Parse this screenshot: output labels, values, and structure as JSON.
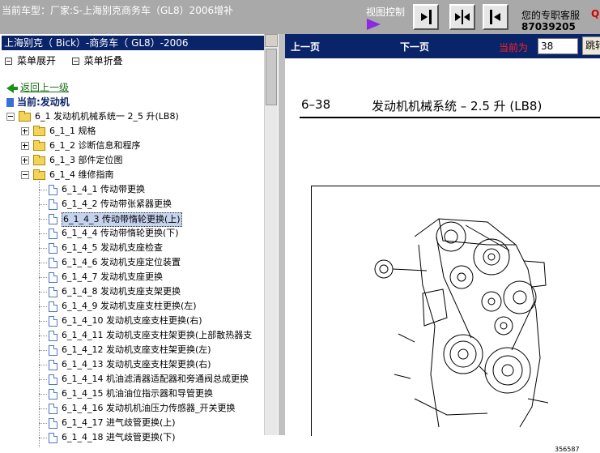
{
  "header": {
    "vehicle_label": "当前车型：厂家:S-上海别克商务车（GL8）2006增补",
    "view_control_label": "视图控制",
    "support_label": "您的专职客服",
    "support_mark": "Q",
    "support_phone": "87039205",
    "view_buttons": [
      "expand-right",
      "split-view",
      "collapse-left"
    ]
  },
  "sidebar": {
    "title": "上海别克（ Bick）-商务车（ GL8）-2006",
    "expand_all": "菜单展开",
    "collapse_all": "菜单折叠",
    "back_label": "返回上一级",
    "current_label": "当前:发动机",
    "tree": [
      {
        "label": "6_1 发动机机械系统一 2_5 升(LB8)",
        "level": 0,
        "type": "folder",
        "expanded": true
      },
      {
        "label": "6_1_1 规格",
        "level": 1,
        "type": "folder",
        "expanded": false
      },
      {
        "label": "6_1_2 诊断信息和程序",
        "level": 1,
        "type": "folder",
        "expanded": false
      },
      {
        "label": "6_1_3 部件定位图",
        "level": 1,
        "type": "folder",
        "expanded": false
      },
      {
        "label": "6_1_4 维修指南",
        "level": 1,
        "type": "folder",
        "expanded": true
      },
      {
        "label": "6_1_4_1 传动带更换",
        "level": 2,
        "type": "page"
      },
      {
        "label": "6_1_4_2 传动带张紧器更换",
        "level": 2,
        "type": "page"
      },
      {
        "label": "6_1_4_3 传动带惰轮更换(上)",
        "level": 2,
        "type": "page",
        "selected": true
      },
      {
        "label": "6_1_4_4 传动带惰轮更换(下)",
        "level": 2,
        "type": "page"
      },
      {
        "label": "6_1_4_5 发动机支座检查",
        "level": 2,
        "type": "page"
      },
      {
        "label": "6_1_4_6 发动机支座定位装置",
        "level": 2,
        "type": "page"
      },
      {
        "label": "6_1_4_7 发动机支座更换",
        "level": 2,
        "type": "page"
      },
      {
        "label": "6_1_4_8 发动机支座支架更换",
        "level": 2,
        "type": "page"
      },
      {
        "label": "6_1_4_9 发动机支座支柱更换(左)",
        "level": 2,
        "type": "page"
      },
      {
        "label": "6_1_4_10 发动机支座支柱更换(右)",
        "level": 2,
        "type": "page"
      },
      {
        "label": "6_1_4_11 发动机支座支柱架更换(上部散热器支",
        "level": 2,
        "type": "page"
      },
      {
        "label": "6_1_4_12 发动机支座支柱架更换(左)",
        "level": 2,
        "type": "page"
      },
      {
        "label": "6_1_4_13 发动机支座支柱架更换(右)",
        "level": 2,
        "type": "page"
      },
      {
        "label": "6_1_4_14 机油滤清器适配器和旁通阀总成更换",
        "level": 2,
        "type": "page"
      },
      {
        "label": "6_1_4_15 机油油位指示器和导管更换",
        "level": 2,
        "type": "page"
      },
      {
        "label": "6_1_4_16 发动机机油压力传感器_开关更换",
        "level": 2,
        "type": "page"
      },
      {
        "label": "6_1_4_17 进气歧管更换(上)",
        "level": 2,
        "type": "page"
      },
      {
        "label": "6_1_4_18 进气歧管更换(下)",
        "level": 2,
        "type": "page"
      }
    ]
  },
  "viewer": {
    "prev_label": "上一页",
    "next_label": "下一页",
    "current_page_label": "当前为",
    "current_page_value": "38",
    "jump_label": "跳转",
    "page_number": "6–38",
    "page_title": "发动机机械系统 – 2.5 升 (LB8)",
    "figure_number": "356587"
  }
}
